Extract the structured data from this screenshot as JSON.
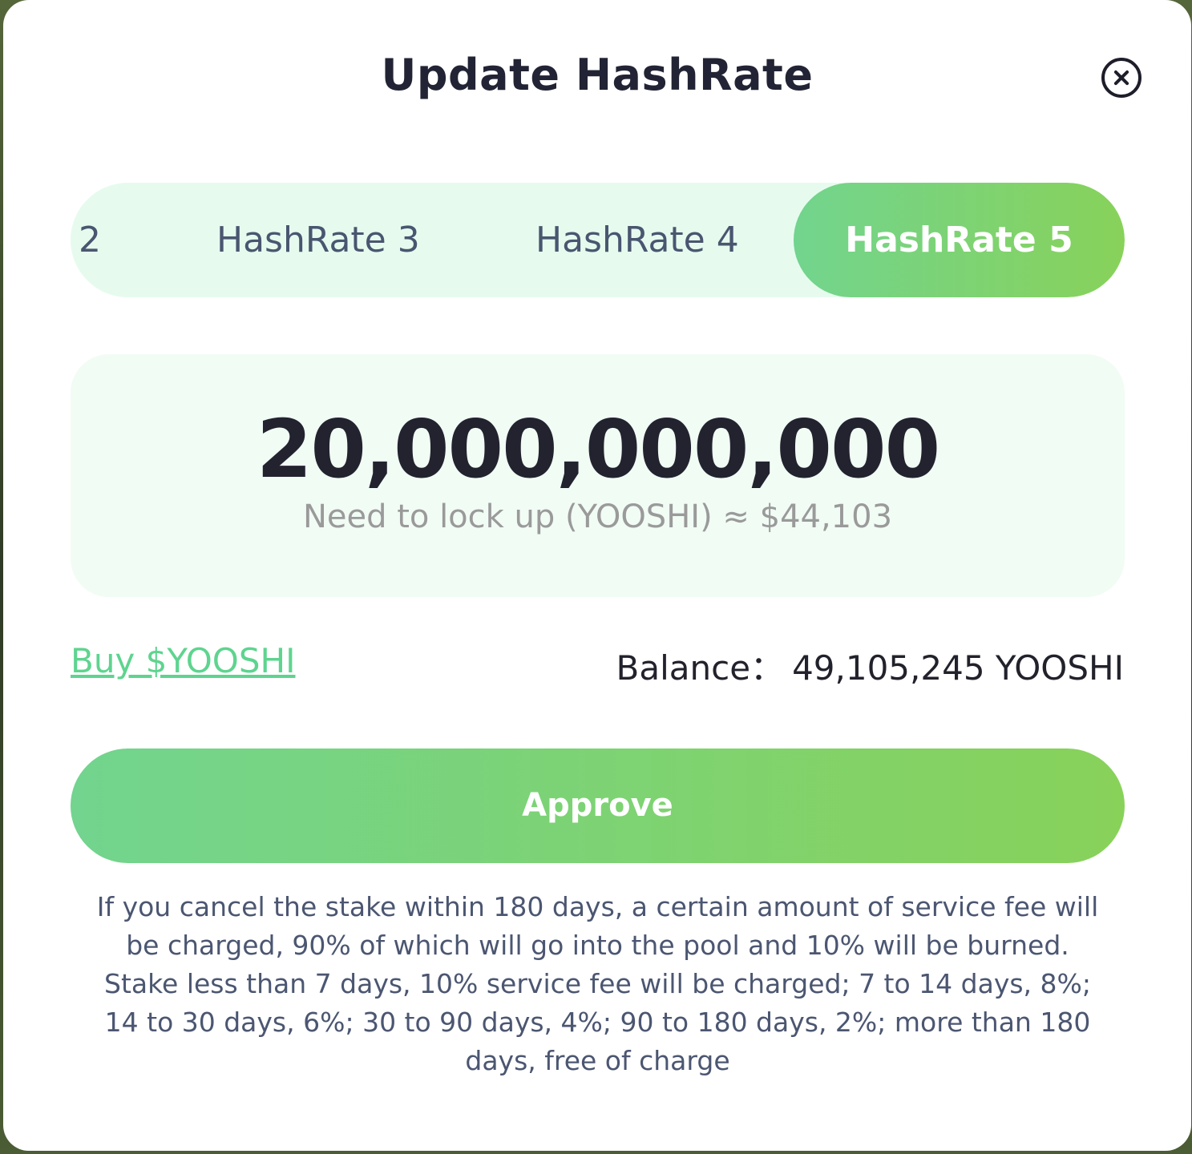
{
  "modal": {
    "title": "Update HashRate",
    "close_icon": "close-circle-icon"
  },
  "tabs": [
    {
      "label": "2",
      "active": false
    },
    {
      "label": "HashRate 3",
      "active": false
    },
    {
      "label": "HashRate 4",
      "active": false
    },
    {
      "label": "HashRate 5",
      "active": true
    }
  ],
  "amount": {
    "value": "20,000,000,000",
    "subtitle": "Need to lock up (YOOSHI) ≈ $44,103"
  },
  "buy_link": "Buy $YOOSHI",
  "balance": {
    "label": "Balance：",
    "value": "49,105,245 YOOSHI"
  },
  "approve_label": "Approve",
  "notice": "If you cancel the stake within 180 days, a certain amount of service fee will be charged, 90% of which will go into the pool and 10% will be burned. Stake less than 7 days, 10% service fee will be charged; 7 to 14 days, 8%; 14 to 30 days, 6%; 30 to 90 days, 4%; 90 to 180 days, 2%; more than 180 days, free of charge",
  "colors": {
    "accent_start": "#72d48e",
    "accent_end": "#88d25a",
    "tab_track": "#e6fbee",
    "link": "#5ed48f",
    "text_dark": "#23232f"
  }
}
